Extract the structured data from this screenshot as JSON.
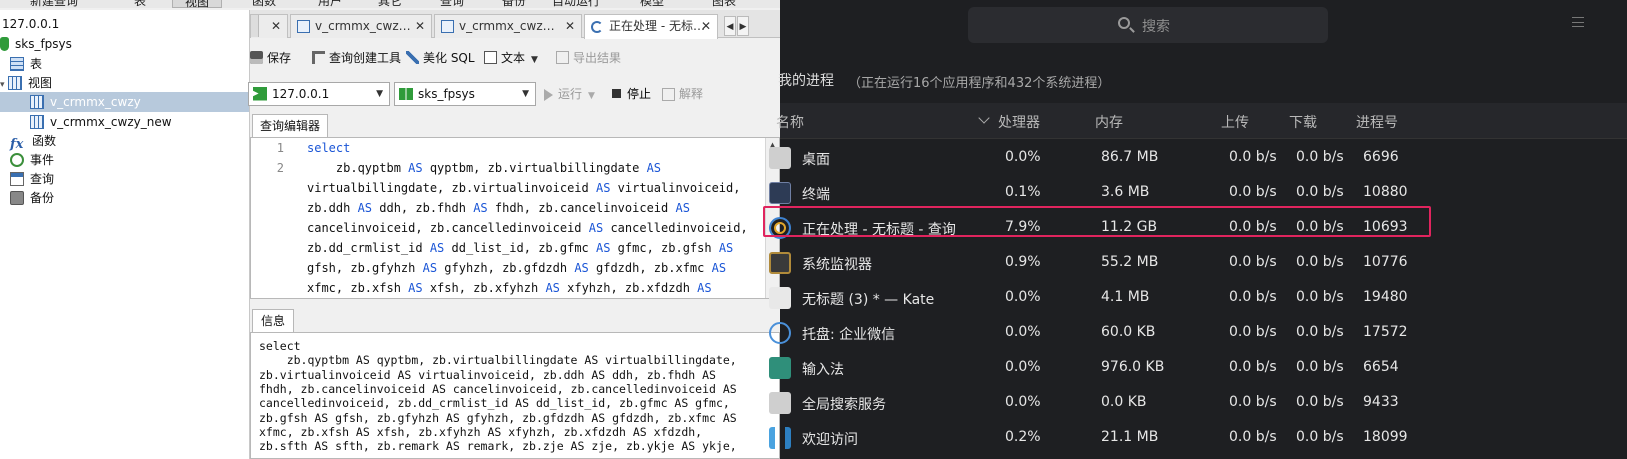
{
  "menubar": {
    "items": [
      "新建查询",
      "表",
      "视图",
      "函数",
      "用户",
      "其它",
      "查询",
      "备份",
      "自动运行",
      "模型",
      "图表"
    ]
  },
  "tree": {
    "connection": "127.0.0.1",
    "database": "sks_fpsys",
    "tables": "表",
    "views": "视图",
    "view_items": [
      "v_crmmx_cwzy",
      "v_crmmx_cwzy_new"
    ],
    "functions": "函数",
    "events": "事件",
    "queries": "查询",
    "backups": "备份"
  },
  "tabs": {
    "items": [
      {
        "label": "v_crmmx_cwz…",
        "close": "✕"
      },
      {
        "label": "v_crmmx_cwz…",
        "close": "✕"
      },
      {
        "label": "正在处理 - 无标…",
        "close": "✕"
      }
    ],
    "first_partial_close": "✕",
    "prev": "◀",
    "next": "▶"
  },
  "toolbar": {
    "save": "保存",
    "query_builder": "查询创建工具",
    "beautify": "美化 SQL",
    "text": "文本",
    "export": "导出结果"
  },
  "selectors": {
    "connection": "127.0.0.1",
    "database": "sks_fpsys",
    "run": "运行",
    "stop": "停止",
    "explain": "解释"
  },
  "editor": {
    "tab_label": "查询编辑器",
    "line_numbers": [
      "1",
      "2"
    ],
    "lines": [
      [
        {
          "k": "select"
        }
      ],
      [
        {
          "t": "    zb.qyptbm "
        },
        {
          "k": "AS"
        },
        {
          "t": " qyptbm, zb.virtualbillingdate "
        },
        {
          "k": "AS"
        }
      ],
      [
        {
          "t": "virtualbillingdate, zb.virtualinvoiceid "
        },
        {
          "k": "AS"
        },
        {
          "t": " virtualinvoiceid,"
        }
      ],
      [
        {
          "t": "zb.ddh "
        },
        {
          "k": "AS"
        },
        {
          "t": " ddh, zb.fhdh "
        },
        {
          "k": "AS"
        },
        {
          "t": " fhdh, zb.cancelinvoiceid "
        },
        {
          "k": "AS"
        }
      ],
      [
        {
          "t": "cancelinvoiceid, zb.cancelledinvoiceid "
        },
        {
          "k": "AS"
        },
        {
          "t": " cancelledinvoiceid,"
        }
      ],
      [
        {
          "t": "zb.dd_crmlist_id "
        },
        {
          "k": "AS"
        },
        {
          "t": " dd_list_id, zb.gfmc "
        },
        {
          "k": "AS"
        },
        {
          "t": " gfmc, zb.gfsh "
        },
        {
          "k": "AS"
        }
      ],
      [
        {
          "t": "gfsh, zb.gfyhzh "
        },
        {
          "k": "AS"
        },
        {
          "t": " gfyhzh, zb.gfdzdh "
        },
        {
          "k": "AS"
        },
        {
          "t": " gfdzdh, zb.xfmc "
        },
        {
          "k": "AS"
        }
      ],
      [
        {
          "t": "xfmc, zb.xfsh "
        },
        {
          "k": "AS"
        },
        {
          "t": " xfsh, zb.xfyhzh "
        },
        {
          "k": "AS"
        },
        {
          "t": " xfyhzh, zb.xfdzdh "
        },
        {
          "k": "AS"
        }
      ]
    ]
  },
  "info": {
    "tab_label": "信息",
    "lines": [
      "select",
      "    zb.qyptbm AS qyptbm, zb.virtualbillingdate AS virtualbillingdate,",
      "zb.virtualinvoiceid AS virtualinvoiceid, zb.ddh AS ddh, zb.fhdh AS",
      "fhdh, zb.cancelinvoiceid AS cancelinvoiceid, zb.cancelledinvoiceid AS",
      "cancelledinvoiceid, zb.dd_crmlist_id AS dd_list_id, zb.gfmc AS gfmc,",
      "zb.gfsh AS gfsh, zb.gfyhzh AS gfyhzh, zb.gfdzdh AS gfdzdh, zb.xfmc AS",
      "xfmc, zb.xfsh AS xfsh, zb.xfyhzh AS xfyhzh, zb.xfdzdh AS xfdzdh,",
      "zb.sfth AS sfth, zb.remark AS remark, zb.zje AS zje, zb.ykje AS ykje,"
    ]
  },
  "monitor": {
    "search_placeholder": "搜索",
    "section_title": "我的进程",
    "section_subtitle": "（正在运行16个应用程序和432个系统进程）",
    "columns": {
      "name": "名称",
      "cpu": "处理器",
      "memory": "内存",
      "upload": "上传",
      "download": "下载",
      "pid": "进程号"
    },
    "processes": [
      {
        "name": "桌面",
        "cpu": "0.0%",
        "memory": "86.7 MB",
        "upload": "0.0 b/s",
        "download": "0.0 b/s",
        "pid": "6696",
        "icon": "desktop-icon"
      },
      {
        "name": "终端",
        "cpu": "0.1%",
        "memory": "3.6 MB",
        "upload": "0.0 b/s",
        "download": "0.0 b/s",
        "pid": "10880",
        "icon": "terminal-icon"
      },
      {
        "name": "正在处理 - 无标题 - 查询",
        "cpu": "7.9%",
        "memory": "11.2 GB",
        "upload": "0.0 b/s",
        "download": "0.0 b/s",
        "pid": "10693",
        "icon": "navicat-icon"
      },
      {
        "name": "系统监视器",
        "cpu": "0.9%",
        "memory": "55.2 MB",
        "upload": "0.0 b/s",
        "download": "0.0 b/s",
        "pid": "10776",
        "icon": "system-monitor-icon"
      },
      {
        "name": "无标题 (3) * — Kate",
        "cpu": "0.0%",
        "memory": "4.1 MB",
        "upload": "0.0 b/s",
        "download": "0.0 b/s",
        "pid": "19480",
        "icon": "kate-icon"
      },
      {
        "name": "托盘: 企业微信",
        "cpu": "0.0%",
        "memory": "60.0 KB",
        "upload": "0.0 b/s",
        "download": "0.0 b/s",
        "pid": "17572",
        "icon": "wecom-icon"
      },
      {
        "name": "输入法",
        "cpu": "0.0%",
        "memory": "976.0 KB",
        "upload": "0.0 b/s",
        "download": "0.0 b/s",
        "pid": "6654",
        "icon": "input-method-icon"
      },
      {
        "name": "全局搜索服务",
        "cpu": "0.0%",
        "memory": "0.0 KB",
        "upload": "0.0 b/s",
        "download": "0.0 b/s",
        "pid": "9433",
        "icon": "global-search-icon"
      },
      {
        "name": "欢迎访问",
        "cpu": "0.2%",
        "memory": "21.1 MB",
        "upload": "0.0 b/s",
        "download": "0.0 b/s",
        "pid": "18099",
        "icon": "welcome-icon"
      }
    ],
    "highlight_color": "#e0245e"
  }
}
